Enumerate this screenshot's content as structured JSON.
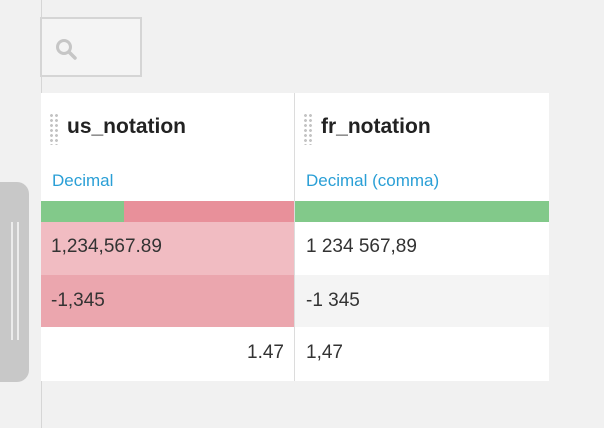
{
  "search": {
    "icon": "search-icon",
    "value": ""
  },
  "columns": [
    {
      "name": "us_notation",
      "meaning": "Decimal",
      "quality": {
        "valid_fraction": 0.33,
        "invalid_fraction": 0.67
      },
      "cells": [
        "1,234,567.89",
        "-1,345",
        "1.47"
      ],
      "cell_status": [
        "invalid",
        "invalid",
        "valid"
      ]
    },
    {
      "name": "fr_notation",
      "meaning": "Decimal (comma)",
      "quality": {
        "valid_fraction": 1.0,
        "invalid_fraction": 0.0
      },
      "cells": [
        "1 234 567,89",
        "-1 345",
        "1,47"
      ],
      "cell_status": [
        "valid",
        "valid",
        "valid"
      ]
    }
  ],
  "colors": {
    "meaning_link": "#2a9fd6",
    "valid": "#82c98a",
    "invalid": "#e8909a"
  }
}
